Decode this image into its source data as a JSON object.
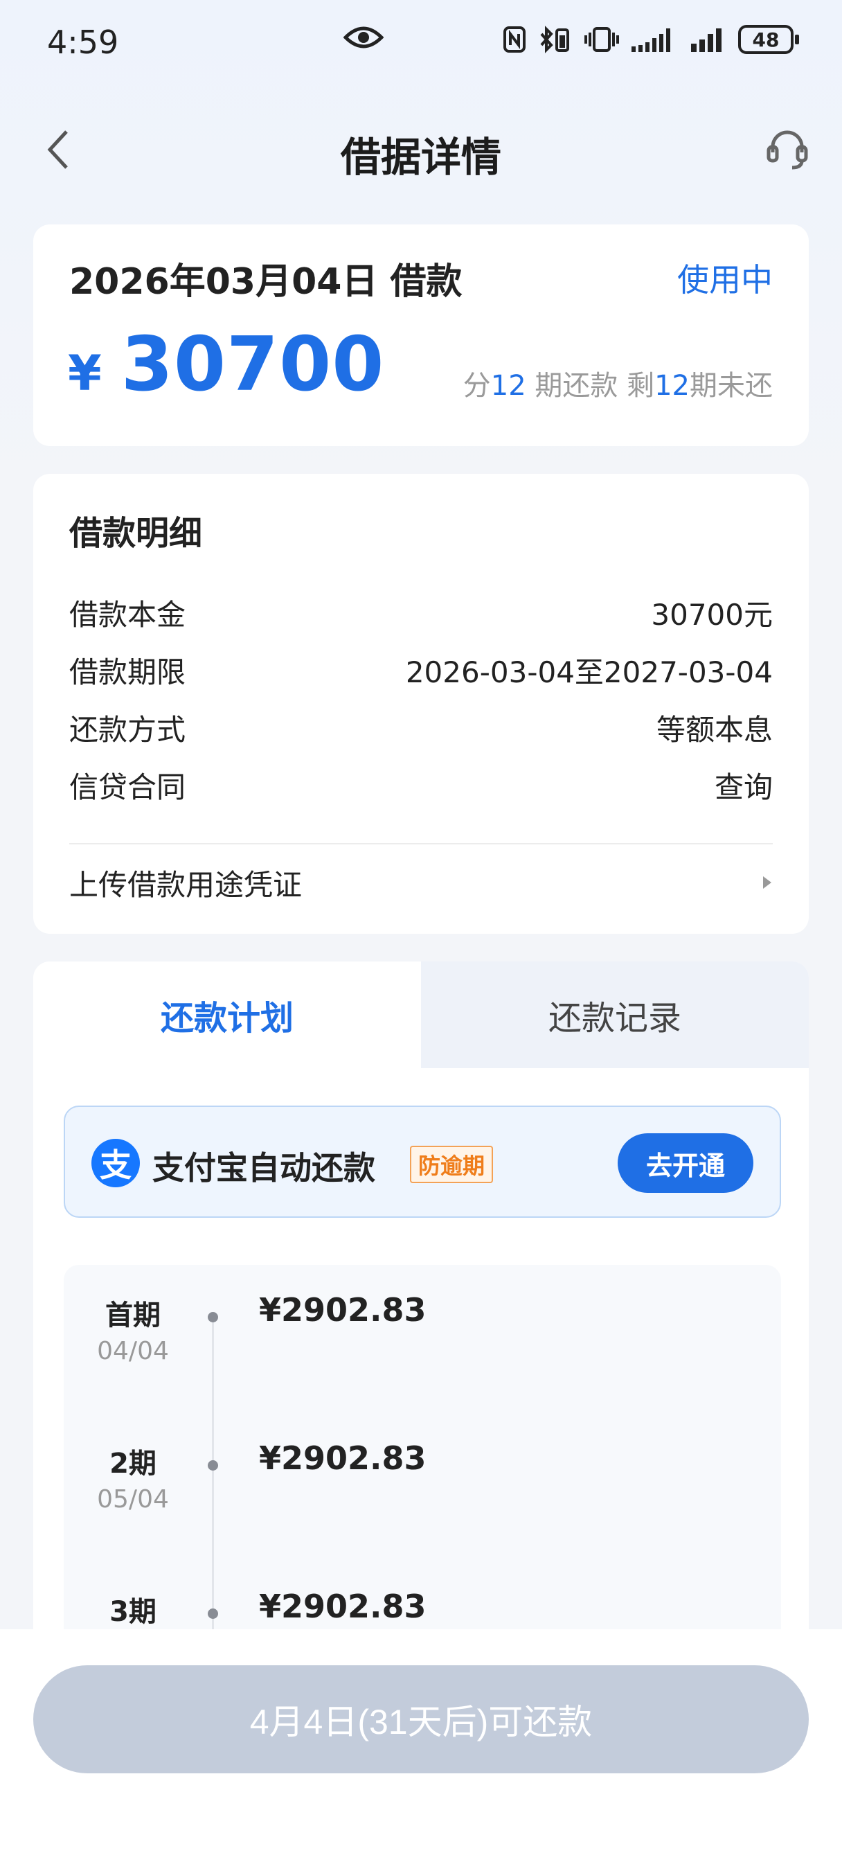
{
  "status_bar": {
    "time": "4:59",
    "battery": "48"
  },
  "header": {
    "title": "借据详情"
  },
  "summary": {
    "date": "2026年03月04日 借款",
    "status": "使用中",
    "currency": "¥",
    "amount": "30700",
    "term_prefix": "分",
    "term_total": "12",
    "term_mid": " 期还款 剩",
    "term_remaining": "12",
    "term_suffix": "期未还"
  },
  "detail": {
    "title": "借款明细",
    "rows": [
      {
        "label": "借款本金",
        "value": "30700元"
      },
      {
        "label": "借款期限",
        "value": "2026-03-04至2027-03-04"
      },
      {
        "label": "还款方式",
        "value": "等额本息"
      },
      {
        "label": "信贷合同",
        "value": "查询"
      }
    ],
    "upload_label": "上传借款用途凭证"
  },
  "tabs": [
    {
      "label": "还款计划",
      "active": true
    },
    {
      "label": "还款记录",
      "active": false
    }
  ],
  "alipay": {
    "logo_char": "支",
    "text": "支付宝自动还款",
    "badge": "防逾期",
    "button": "去开通"
  },
  "installments": [
    {
      "name": "首期",
      "date": "04/04",
      "amount": "¥2902.83"
    },
    {
      "name": "2期",
      "date": "05/04",
      "amount": "¥2902.83"
    },
    {
      "name": "3期",
      "date": "",
      "amount": "¥2902.83"
    }
  ],
  "footer": {
    "repay_button": "4月4日(31天后)可还款"
  },
  "colors": {
    "accent": "#1f6fe5",
    "badge": "#ef7d1a",
    "disabled_button": "#c3ccdb"
  }
}
